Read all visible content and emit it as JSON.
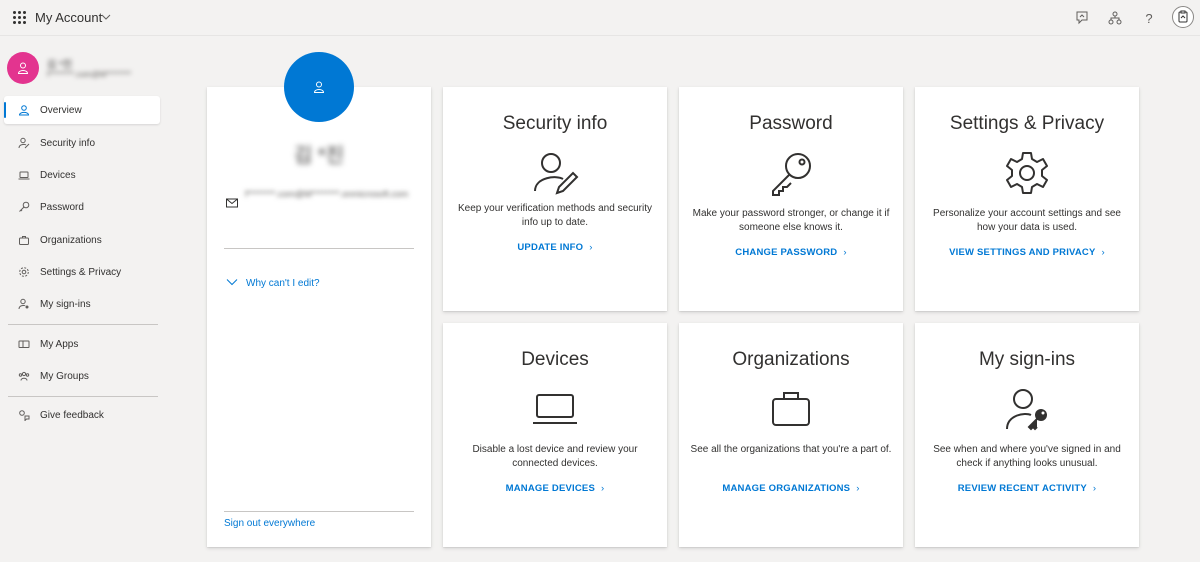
{
  "header": {
    "app_title": "My Account",
    "icons": [
      "app-launcher-icon",
      "feedback-icon",
      "organization-icon",
      "help-icon",
      "user-account-icon"
    ],
    "help_glyph": "?"
  },
  "user": {
    "name": "김 *진",
    "email": "f********.com@M********"
  },
  "sidebar": {
    "items": [
      {
        "label": "Overview",
        "icon": "person-icon",
        "active": true
      },
      {
        "label": "Security info",
        "icon": "security-info-icon"
      },
      {
        "label": "Devices",
        "icon": "laptop-icon"
      },
      {
        "label": "Password",
        "icon": "key-icon"
      },
      {
        "label": "Organizations",
        "icon": "briefcase-icon"
      },
      {
        "label": "Settings & Privacy",
        "icon": "gear-icon"
      },
      {
        "label": "My sign-ins",
        "icon": "sign-ins-icon"
      },
      {
        "label": "My Apps",
        "icon": "apps-icon"
      },
      {
        "label": "My Groups",
        "icon": "groups-icon"
      },
      {
        "label": "Give feedback",
        "icon": "feedback-icon"
      }
    ]
  },
  "profile": {
    "name": "김 *진",
    "email": "f********.com@M********.onmicrosoft.com",
    "why_edit": "Why can't I edit?",
    "sign_out": "Sign out everywhere"
  },
  "tiles": [
    {
      "title": "Security info",
      "desc": "Keep your verification methods and security info up to date.",
      "link": "UPDATE INFO",
      "icon": "security-info-icon"
    },
    {
      "title": "Password",
      "desc": "Make your password stronger, or change it if someone else knows it.",
      "link": "CHANGE PASSWORD",
      "icon": "key-icon"
    },
    {
      "title": "Settings & Privacy",
      "desc": "Personalize your account settings and see how your data is used.",
      "link": "VIEW SETTINGS AND PRIVACY",
      "icon": "gear-icon"
    },
    {
      "title": "Devices",
      "desc": "Disable a lost device and review your connected devices.",
      "link": "MANAGE DEVICES",
      "icon": "laptop-icon"
    },
    {
      "title": "Organizations",
      "desc": "See all the organizations that you're a part of.",
      "link": "MANAGE ORGANIZATIONS",
      "icon": "briefcase-icon"
    },
    {
      "title": "My sign-ins",
      "desc": "See when and where you've signed in and check if anything looks unusual.",
      "link": "REVIEW RECENT ACTIVITY",
      "icon": "sign-ins-icon"
    }
  ],
  "colors": {
    "accent": "#0078d4",
    "avatar_pink": "#e3348f",
    "background": "#f3f2f1"
  }
}
